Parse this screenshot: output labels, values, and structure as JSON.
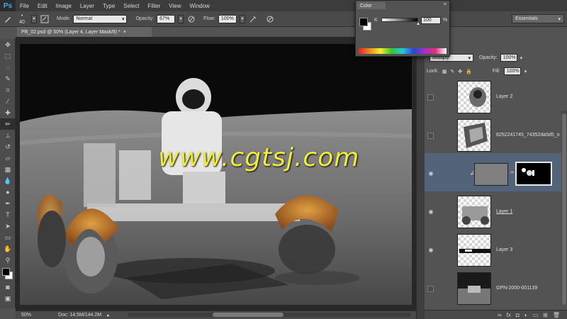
{
  "menubar": {
    "logo": "Ps",
    "items": [
      "File",
      "Edit",
      "Image",
      "Layer",
      "Type",
      "Select",
      "Filter",
      "View",
      "Window"
    ]
  },
  "options": {
    "brush_size": "40",
    "mode_label": "Mode:",
    "mode_value": "Normal",
    "opacity_label": "Opacity:",
    "opacity_value": "67%",
    "flow_label": "Flow:",
    "flow_value": "100%",
    "workspace": "Essentials"
  },
  "document": {
    "tab_title": "PB_02.psd @ 50% (Layer 4, Layer Mask/8) *",
    "close": "×"
  },
  "canvas": {
    "watermark": "www.cgtsj.com"
  },
  "status": {
    "zoom": "50%",
    "doc_info": "Doc: 14.5M/144.2M"
  },
  "color_panel": {
    "tab": "Color",
    "channel_label": "K",
    "channel_value": "100",
    "unit": "%"
  },
  "layers_panel": {
    "blend_mode": "Multiply",
    "opacity_label": "Opacity:",
    "opacity_value": "100%",
    "lock_label": "Lock:",
    "fill_label": "Fill:",
    "fill_value": "100%",
    "layers": [
      {
        "name": "Layer 2",
        "visible": false
      },
      {
        "name": "8252241745_74352da5d5_o",
        "visible": false
      },
      {
        "name": "",
        "visible": true,
        "selected": true
      },
      {
        "name": "Layer 1",
        "visible": true
      },
      {
        "name": "Layer 3",
        "visible": true
      },
      {
        "name": "GPN-2000-001139",
        "visible": false
      }
    ]
  },
  "tools": [
    "move-tool",
    "marquee-tool",
    "lasso-tool",
    "quick-select-tool",
    "crop-tool",
    "eyedropper-tool",
    "healing-tool",
    "brush-tool",
    "clone-stamp-tool",
    "history-brush-tool",
    "eraser-tool",
    "gradient-tool",
    "blur-tool",
    "dodge-tool",
    "pen-tool",
    "type-tool",
    "path-select-tool",
    "rectangle-tool",
    "hand-tool",
    "zoom-tool"
  ],
  "colors": {
    "foreground": "#000000",
    "background": "#ffffff",
    "watermark": "#f0ec3a",
    "selection": "#53637a"
  }
}
